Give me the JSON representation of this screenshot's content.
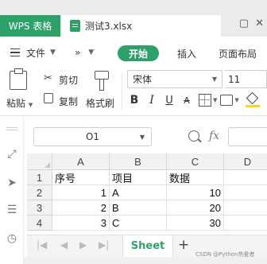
{
  "titlebar": {
    "app_tab": "WPS 表格",
    "doc_tab": "测试3.xlsx"
  },
  "menubar": {
    "file": "文件",
    "more": "»",
    "start": "开始",
    "insert": "插入",
    "page_layout": "页面布局"
  },
  "ribbon": {
    "paste": "粘贴",
    "cut": "剪切",
    "copy": "复制",
    "format_painter": "格式刷",
    "font_name": "宋体",
    "font_size": "11",
    "bold": "B",
    "italic": "I",
    "underline": "U",
    "strikethrough": "A"
  },
  "formula_bar": {
    "name_box": "O1",
    "fx": "fx",
    "formula": ""
  },
  "grid": {
    "columns": [
      "A",
      "B",
      "C",
      "D"
    ],
    "rows": [
      {
        "num": "1",
        "cells": [
          "序号",
          "项目",
          "数据",
          ""
        ]
      },
      {
        "num": "2",
        "cells": [
          "1",
          "A",
          "10",
          ""
        ]
      },
      {
        "num": "3",
        "cells": [
          "2",
          "B",
          "20",
          ""
        ]
      },
      {
        "num": "4",
        "cells": [
          "3",
          "C",
          "30",
          ""
        ]
      }
    ]
  },
  "sheets": {
    "active": "Sheet",
    "add": "+"
  },
  "watermark": "CSDN @Python热爱者",
  "colors": {
    "accent": "#2ea16b",
    "fill_color": "#f3d61f"
  }
}
